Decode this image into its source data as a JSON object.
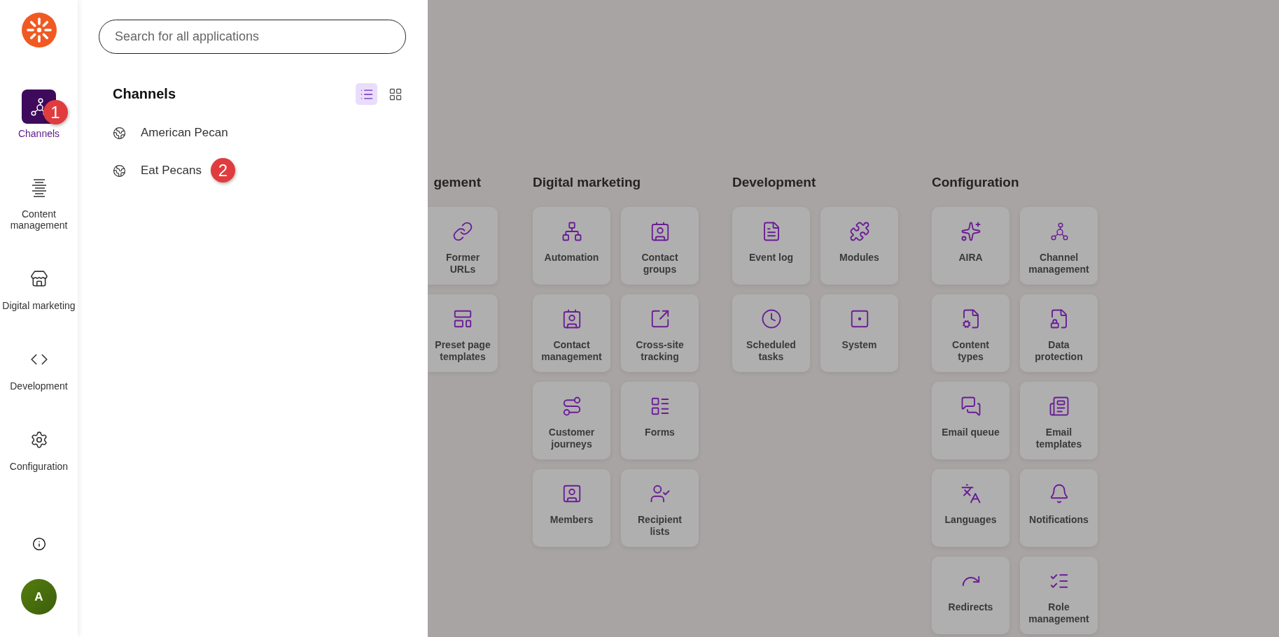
{
  "nav": {
    "items": [
      {
        "label": "Channels",
        "selected": true,
        "marker": "1"
      },
      {
        "label": "Content management",
        "selected": false
      },
      {
        "label": "Digital marketing",
        "selected": false
      },
      {
        "label": "Development",
        "selected": false
      },
      {
        "label": "Configuration",
        "selected": false
      }
    ],
    "avatar": "A"
  },
  "flyout": {
    "search": {
      "placeholder": "Search for all applications"
    },
    "title": "Channels",
    "views": [
      {
        "kind": "list",
        "selected": true
      },
      {
        "kind": "grid",
        "selected": false
      }
    ],
    "items": [
      {
        "label": "American Pecan"
      },
      {
        "label": "Eat Pecans",
        "marker": "2"
      }
    ]
  },
  "sections": [
    {
      "heading": "gement",
      "partial": true,
      "tiles": [
        {
          "label": "Former URLs"
        },
        {
          "label": "Preset page templates"
        }
      ]
    },
    {
      "heading": "Digital marketing",
      "partial": false,
      "tiles": [
        {
          "label": "Automation"
        },
        {
          "label": "Contact groups"
        },
        {
          "label": "Contact management"
        },
        {
          "label": "Cross-site tracking"
        },
        {
          "label": "Customer journeys"
        },
        {
          "label": "Forms"
        },
        {
          "label": "Members"
        },
        {
          "label": "Recipient lists"
        }
      ]
    },
    {
      "heading": "Development",
      "partial": false,
      "tiles": [
        {
          "label": "Event log"
        },
        {
          "label": "Modules"
        },
        {
          "label": "Scheduled tasks"
        },
        {
          "label": "System"
        }
      ]
    },
    {
      "heading": "Configuration",
      "partial": false,
      "tiles": [
        {
          "label": "AIRA"
        },
        {
          "label": "Channel management"
        },
        {
          "label": "Content types"
        },
        {
          "label": "Data protection"
        },
        {
          "label": "Email queue"
        },
        {
          "label": "Email templates"
        },
        {
          "label": "Languages"
        },
        {
          "label": "Notifications"
        },
        {
          "label": "Redirects"
        },
        {
          "label": "Role management"
        }
      ]
    }
  ]
}
